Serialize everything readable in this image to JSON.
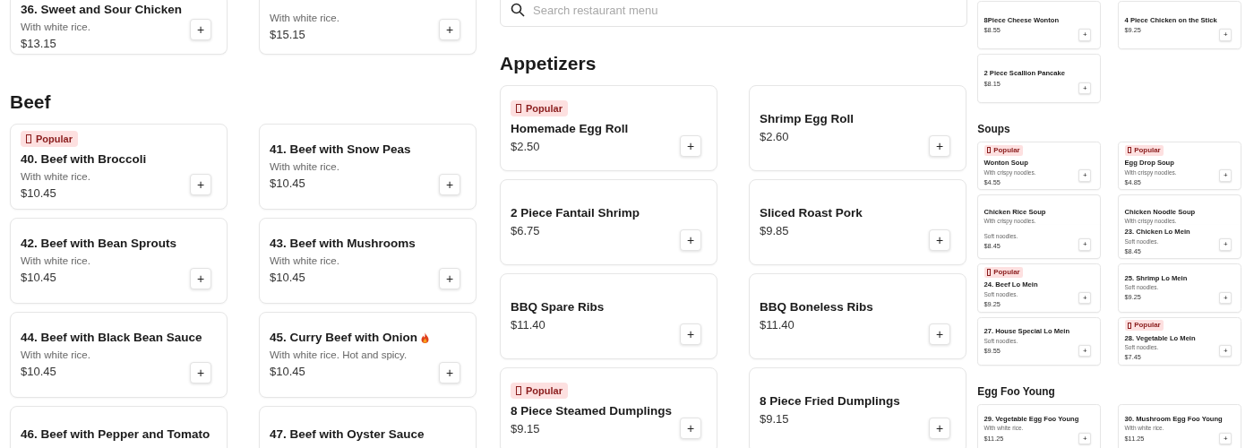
{
  "left": {
    "sections": [
      {
        "items": [
          {
            "title": "36. Sweet and Sour Chicken",
            "desc": "With white rice.",
            "price": "$13.15",
            "button": "+"
          },
          {
            "desc": "With white rice.",
            "price": "$15.15",
            "button": "+"
          }
        ]
      },
      {
        "heading": "Beef",
        "items": [
          {
            "badge": "Popular",
            "title": "40. Beef with Broccoli",
            "desc": "With white rice.",
            "price": "$10.45",
            "button": "+"
          },
          {
            "title": "41. Beef with Snow Peas",
            "desc": "With white rice.",
            "price": "$10.45",
            "button": "+"
          },
          {
            "title": "42. Beef with Bean Sprouts",
            "desc": "With white rice.",
            "price": "$10.45",
            "button": "+"
          },
          {
            "title": "43. Beef with Mushrooms",
            "desc": "With white rice.",
            "price": "$10.45",
            "button": "+"
          },
          {
            "title": "44. Beef with Black Bean Sauce",
            "desc": "With white rice.",
            "price": "$10.45",
            "button": "+"
          },
          {
            "title": "45. Curry Beef with Onion",
            "spicy": true,
            "desc": "With white rice. Hot and spicy.",
            "price": "$10.45",
            "button": "+"
          },
          {
            "title": "46. Beef with Pepper and Tomato"
          },
          {
            "title": "47. Beef with Oyster Sauce"
          }
        ]
      }
    ]
  },
  "middle": {
    "search": {
      "placeholder": "Search restaurant menu"
    },
    "sections": [
      {
        "heading": "Appetizers",
        "items": [
          {
            "badge": "Popular",
            "title": "Homemade Egg Roll",
            "price": "$2.50",
            "button": "+"
          },
          {
            "title": "Shrimp Egg Roll",
            "price": "$2.60",
            "button": "+"
          },
          {
            "title": "2 Piece Fantail Shrimp",
            "price": "$6.75",
            "button": "+"
          },
          {
            "title": "Sliced Roast Pork",
            "price": "$9.85",
            "button": "+"
          },
          {
            "title": "BBQ Spare Ribs",
            "price": "$11.40",
            "button": "+"
          },
          {
            "title": "BBQ Boneless Ribs",
            "price": "$11.40",
            "button": "+"
          },
          {
            "badge": "Popular",
            "title": "8 Piece Steamed Dumplings",
            "price": "$9.15",
            "button": "+"
          },
          {
            "title": "8 Piece Fried Dumplings",
            "price": "$9.15",
            "button": "+"
          }
        ]
      }
    ]
  },
  "right": {
    "sections": [
      {
        "items": [
          {
            "title": "8Piece Cheese Wonton",
            "price": "$8.55",
            "button": "+"
          },
          {
            "title": "4 Piece Chicken on the Stick",
            "price": "$9.25",
            "button": "+"
          },
          {
            "title": "2 Piece Scallion Pancake",
            "price": "$8.15",
            "button": "+"
          }
        ]
      },
      {
        "heading": "Soups",
        "items": [
          {
            "badge": "Popular",
            "title": "Wonton Soup",
            "desc": "With crispy noodles.",
            "price": "$4.55",
            "button": "+"
          },
          {
            "badge": "Popular",
            "title": "Egg Drop Soup",
            "desc": "With crispy noodles.",
            "price": "$4.85",
            "button": "+"
          },
          {
            "title": "Chicken Rice Soup",
            "desc": "With crispy noodles.",
            "clipped": true
          },
          {
            "title": "Chicken Noodle Soup",
            "desc": "With crispy noodles.",
            "clipped": true
          }
        ]
      },
      {
        "items": [
          {
            "desc": "Soft noodles.",
            "price": "$8.45",
            "button": "+",
            "cut_top": true
          },
          {
            "title": "23. Chicken Lo Mein",
            "desc": "Soft noodles.",
            "price": "$8.45",
            "button": "+",
            "cut_top": true
          },
          {
            "badge": "Popular",
            "title": "24. Beef Lo Mein",
            "desc": "Soft noodles.",
            "price": "$9.25",
            "button": "+"
          },
          {
            "title": "25. Shrimp Lo Mein",
            "desc": "Soft noodles.",
            "price": "$9.25",
            "button": "+"
          },
          {
            "title": "27. House Special Lo Mein",
            "desc": "Soft noodles.",
            "price": "$9.55",
            "button": "+"
          },
          {
            "badge": "Popular",
            "title": "28. Vegetable Lo Mein",
            "desc": "Soft noodles.",
            "price": "$7.45",
            "button": "+"
          }
        ]
      },
      {
        "heading": "Egg Foo Young",
        "items": [
          {
            "title": "29. Vegetable Egg Foo Young",
            "desc": "With white rice.",
            "price": "$11.25",
            "button": "+"
          },
          {
            "title": "30. Mushroom Egg Foo Young",
            "desc": "With white rice.",
            "price": "$11.25",
            "button": "+"
          }
        ]
      }
    ]
  }
}
